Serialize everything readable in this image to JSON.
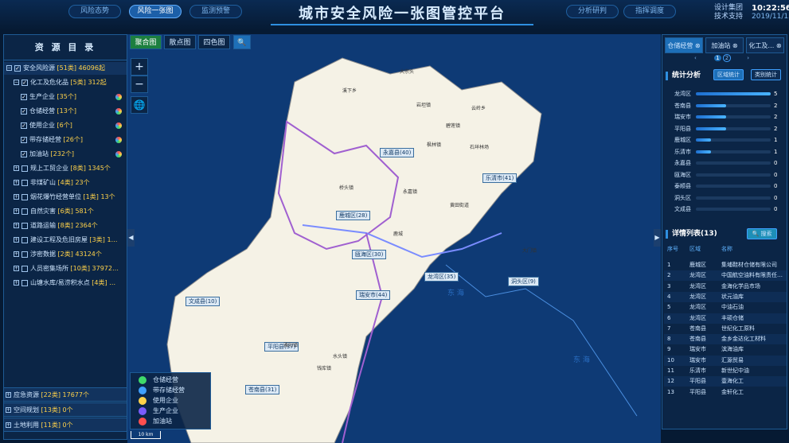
{
  "header": {
    "tabs_left": [
      "风险态势",
      "风险一张图",
      "监测预警"
    ],
    "tabs_right": [
      "分析研判",
      "指挥调度"
    ],
    "title": "城市安全风险一张图管控平台",
    "corp": "设计集团 技术支持",
    "time": "10:22:56",
    "date": "2019/11/15"
  },
  "left": {
    "title": "资 源 目 录",
    "tree": [
      {
        "label": "安全风险源",
        "count": "[51类]",
        "total": "46096起",
        "expanded": true,
        "checked": true,
        "level": 0
      },
      {
        "label": "化工及危化品",
        "count": "[5类]",
        "total": "312起",
        "expanded": true,
        "checked": true,
        "level": 1
      },
      {
        "label": "生产企业",
        "count": "[35个]",
        "checked": true,
        "level": 2
      },
      {
        "label": "仓储经营",
        "count": "[13个]",
        "checked": true,
        "level": 2
      },
      {
        "label": "使用企业",
        "count": "[6个]",
        "checked": true,
        "level": 2
      },
      {
        "label": "带存储经营",
        "count": "[26个]",
        "checked": true,
        "level": 2
      },
      {
        "label": "加油站",
        "count": "[232个]",
        "checked": true,
        "level": 2
      },
      {
        "label": "规上工贸企业",
        "count": "[8类]",
        "total": "1345个",
        "level": 1
      },
      {
        "label": "非煤矿山",
        "count": "[4类]",
        "total": "23个",
        "level": 1
      },
      {
        "label": "烟花爆竹经营单位",
        "count": "[1类]",
        "total": "13个",
        "level": 1
      },
      {
        "label": "自然灾害",
        "count": "[6类]",
        "total": "581个",
        "level": 1
      },
      {
        "label": "道路运输",
        "count": "[8类]",
        "total": "2364个",
        "level": 1
      },
      {
        "label": "建设工程及危旧房屋",
        "count": "[3类]",
        "total": "1…",
        "level": 1
      },
      {
        "label": "涉密数据",
        "count": "[2类]",
        "total": "43124个",
        "level": 1
      },
      {
        "label": "人员密集场所",
        "count": "[10类]",
        "total": "37972…",
        "level": 1
      },
      {
        "label": "山塘水库/易涝积水点",
        "count": "[4类]",
        "total": "…",
        "level": 1
      }
    ],
    "bottom": [
      {
        "label": "应急资源",
        "count": "[22类]",
        "total": "17677个"
      },
      {
        "label": "空间规划",
        "count": "[13类]",
        "total": "0个"
      },
      {
        "label": "土地利用",
        "count": "[11类]",
        "total": "0个"
      }
    ]
  },
  "map": {
    "tabs": [
      "聚合图",
      "散点图",
      "四色图"
    ],
    "zoom_in": "+",
    "zoom_out": "−",
    "regions": [
      {
        "name": "永嘉县(40)"
      },
      {
        "name": "乐清市(41)"
      },
      {
        "name": "鹿城区(28)"
      },
      {
        "name": "瓯海区(30)"
      },
      {
        "name": "龙湾区(35)"
      },
      {
        "name": "洞头区(9)"
      },
      {
        "name": "瑞安市(44)"
      },
      {
        "name": "文成县(10)"
      },
      {
        "name": "平阳县(37)"
      },
      {
        "name": "苍南县(31)"
      }
    ],
    "cities": [
      "大宗头",
      "溪下乡",
      "岩坦镇",
      "云岭乡",
      "碧莲镇",
      "枫林镇",
      "桥头镇",
      "永嘉镇",
      "黄田街道",
      "鹿城",
      "大门镇",
      "东 海",
      "石垟林场",
      "雅阳镇",
      "东 海",
      "钱库镇",
      "水头镇"
    ],
    "legend": [
      {
        "label": "仓储经营",
        "color": "#3fd96a"
      },
      {
        "label": "带存储经营",
        "color": "#3fa0ff"
      },
      {
        "label": "使用企业",
        "color": "#ffd24a"
      },
      {
        "label": "生产企业",
        "color": "#7a5cff"
      },
      {
        "label": "加油站",
        "color": "#ff4f4f"
      }
    ],
    "scale": "10 km"
  },
  "right": {
    "tabs": [
      "仓储经营",
      "加油站",
      "化工及…"
    ],
    "pager": [
      "1",
      "2"
    ],
    "stats_title": "统计分析",
    "stats_btns": [
      "区域统计",
      "类别统计"
    ],
    "stats": [
      {
        "name": "龙湾区",
        "value": 5
      },
      {
        "name": "苍南县",
        "value": 2
      },
      {
        "name": "瑞安市",
        "value": 2
      },
      {
        "name": "平阳县",
        "value": 2
      },
      {
        "name": "鹿城区",
        "value": 1
      },
      {
        "name": "乐清市",
        "value": 1
      },
      {
        "name": "永嘉县",
        "value": 0
      },
      {
        "name": "瓯海区",
        "value": 0
      },
      {
        "name": "泰顺县",
        "value": 0
      },
      {
        "name": "洞头区",
        "value": 0
      },
      {
        "name": "文成县",
        "value": 0
      }
    ],
    "list_title": "详情列表(13)",
    "search_label": "搜索",
    "cols": [
      "序号",
      "区域",
      "名称"
    ],
    "rows": [
      [
        "1",
        "鹿城区",
        "集埔鞋材仓储有限公司"
      ],
      [
        "2",
        "龙湾区",
        "中国航空油料有限责任…"
      ],
      [
        "3",
        "龙湾区",
        "金海化学品市场"
      ],
      [
        "4",
        "龙湾区",
        "状元油库"
      ],
      [
        "5",
        "龙湾区",
        "中油石油"
      ],
      [
        "6",
        "龙湾区",
        "丰硕仓储"
      ],
      [
        "7",
        "苍南县",
        "世纪化工原料"
      ],
      [
        "8",
        "苍南县",
        "金乡金达化工材料"
      ],
      [
        "9",
        "瑞安市",
        "滨海油库"
      ],
      [
        "10",
        "瑞安市",
        "汇源贸易"
      ],
      [
        "11",
        "乐清市",
        "新世纪中油"
      ],
      [
        "12",
        "平阳县",
        "壹海化工"
      ],
      [
        "13",
        "平阳县",
        "金轩化工"
      ]
    ]
  }
}
